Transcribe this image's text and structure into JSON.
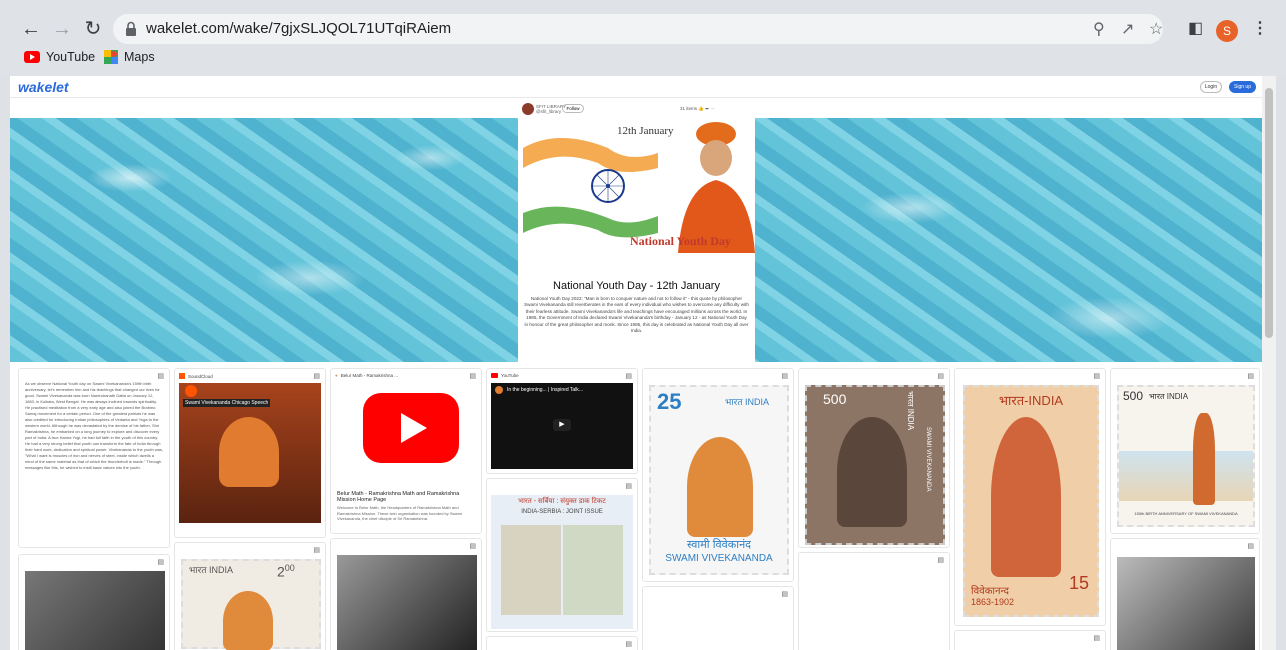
{
  "browser": {
    "url": "wakelet.com/wake/7gjxSLJQOL71UTqiRAiem",
    "avatar_letter": "S",
    "bookmarks": [
      {
        "label": "YouTube",
        "icon": "youtube-icon"
      },
      {
        "label": "Maps",
        "icon": "maps-icon"
      }
    ]
  },
  "wakelet": {
    "logo": "wakelet",
    "login": "Login",
    "signup": "Sign up"
  },
  "collection": {
    "owner": "SFIT LIBRARY",
    "handle": "@sfit_library",
    "follow": "Follow",
    "stats": "31 items",
    "image_date": "12th January",
    "image_caption": "National Youth Day",
    "title": "National Youth Day - 12th January",
    "description": "National Youth Day 2022: \"Man is born to conquer nature and not to follow it\" - this quote by philosopher Swami Vivekananda still reverberates in the ears of every individual who wishes to overcome any difficulty with their fearless attitude. Swami Vivekananda's life and teachings have encouraged millions across the world. In 1985, the Government of India declared Swami Vivekananda's birthday - January 12 - as National Youth Day in honour of the great philosopher and monk. Since 1985, this day is celebrated as National Youth Day all over India."
  },
  "tiles": {
    "text_tile": "As we observe National Youth day on Swami Vivekananda's 159th birth anniversary, let's remember him and his teachings that changed our lives for good. Swami Vivekananda was born Narendranath Datta on January 12, 1863, in Kolkata, West Bengal. He was always inclined towards spirituality. He practised meditation from a very early age and also joined the Brahmo Samaj movement for a certain period. One of the greatest patriots he was also credited for introducing Indian philosophies of Vedanta and Yoga to the western world. Although he was devastated by the demise of his father, Shri Ramakrishna, he embarked on a long journey to explore and discover every part of India. A true Karma Yogi, he had full faith in the youth of this country. He had a very strong belief that youth can transform the fate of India through their hard work, dedication and spiritual power. Vivekananda to the youth was, \"What I want is muscles of iron and nerves of steel, inside which dwells a mind of the same material as that of which the thunderbolt is made.\" Through messages like this, he wished to instil basic values into the youth.",
    "soundcloud_source": "SoundCloud",
    "soundcloud_title": "Swami Vivekananda Chicago Speech",
    "belur_source": "Belur Math - Ramakrishna ...",
    "belur_title": "Belur Math - Ramakrishna Math and Ramakrishna Mission Home Page",
    "belur_desc": "Welcome to Belur Math, the Headquarters of Ramakrishna Math and Ramakrishna Mission. These twin organisation was founded by Swami Vivekananda, the chief disciple of Sri Ramakrishna.",
    "youtube_source": "YouTube",
    "youtube_title": "In the beginning... | Inspired Talk...",
    "stamp1_value": "25",
    "stamp1_country": "भारत INDIA",
    "stamp1_name_hi": "स्वामी विवेकानंद",
    "stamp1_name_en": "SWAMI VIVEKANANDA",
    "stamp2_value": "500",
    "stamp2_country": "भारत INDIA",
    "stamp2_name": "SWAMI VIVEKANANDA",
    "stamp3_country": "भारत-INDIA",
    "stamp3_years": "1863-1902",
    "stamp3_name_hi": "विवेकानन्द",
    "stamp3_value": "15",
    "stamp4_value": "500",
    "stamp4_country": "भारत INDIA",
    "stamp4_caption": "150th BIRTH ANNIVERSARY OF SWAMI VIVEKANANDA",
    "serbia_header": "भारत - सर्बिया : संयुक्त डाक टिकट",
    "serbia_sub": "INDIA-SERBIA : JOINT ISSUE",
    "stamp5_country": "भारत INDIA",
    "stamp5_value": "2",
    "stamp5_value2": "00"
  },
  "colors": {
    "accent": "#2a6bdc",
    "stamp_orange": "#e08a3c",
    "youtube_red": "#ff0000"
  }
}
